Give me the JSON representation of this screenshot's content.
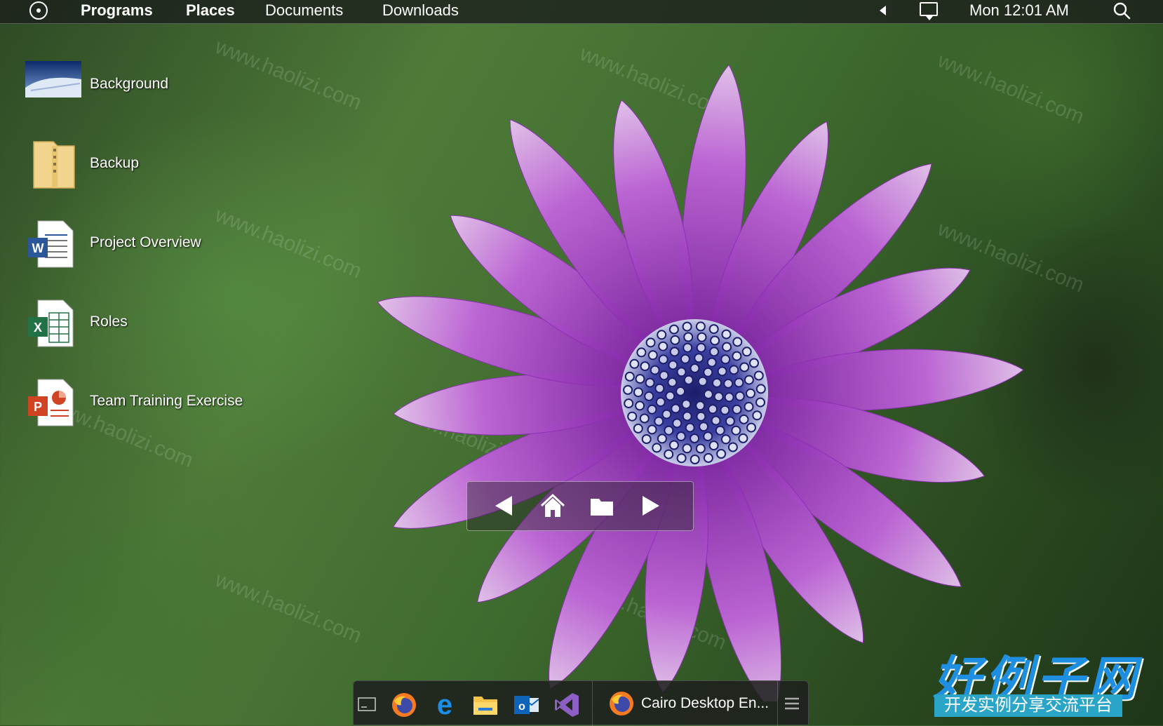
{
  "menubar": {
    "items": [
      "Programs",
      "Places",
      "Documents",
      "Downloads"
    ],
    "clock": "Mon 12:01 AM"
  },
  "desktop_icons": [
    {
      "label": "Background",
      "icon": "image-file-icon"
    },
    {
      "label": "Backup",
      "icon": "zip-folder-icon"
    },
    {
      "label": "Project Overview",
      "icon": "word-document-icon"
    },
    {
      "label": "Roles",
      "icon": "excel-spreadsheet-icon"
    },
    {
      "label": "Team Training Exercise",
      "icon": "powerpoint-icon"
    }
  ],
  "navigator": {
    "buttons": [
      "back-icon",
      "home-icon",
      "folder-icon",
      "forward-icon"
    ]
  },
  "taskbar": {
    "pinned": [
      "show-desktop-icon",
      "firefox-icon",
      "edge-icon",
      "file-explorer-icon",
      "outlook-icon",
      "visual-studio-icon"
    ],
    "task_label": "Cairo Desktop En..."
  },
  "watermark": {
    "text": "www.haolizi.com",
    "brand": "好例子网",
    "brand_sub": "开发实例分享交流平台"
  },
  "colors": {
    "accent_purple": "#b24fd0",
    "flower_center": "#2a2f8a",
    "foliage_green": "#4f7b39",
    "brand_blue": "#1e8fe0"
  }
}
